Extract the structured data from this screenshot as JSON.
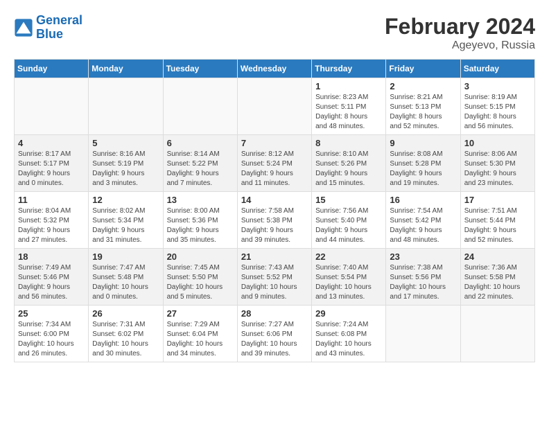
{
  "header": {
    "logo_line1": "General",
    "logo_line2": "Blue",
    "title": "February 2024",
    "subtitle": "Ageyevo, Russia"
  },
  "days_of_week": [
    "Sunday",
    "Monday",
    "Tuesday",
    "Wednesday",
    "Thursday",
    "Friday",
    "Saturday"
  ],
  "weeks": [
    [
      {
        "day": "",
        "info": ""
      },
      {
        "day": "",
        "info": ""
      },
      {
        "day": "",
        "info": ""
      },
      {
        "day": "",
        "info": ""
      },
      {
        "day": "1",
        "info": "Sunrise: 8:23 AM\nSunset: 5:11 PM\nDaylight: 8 hours\nand 48 minutes."
      },
      {
        "day": "2",
        "info": "Sunrise: 8:21 AM\nSunset: 5:13 PM\nDaylight: 8 hours\nand 52 minutes."
      },
      {
        "day": "3",
        "info": "Sunrise: 8:19 AM\nSunset: 5:15 PM\nDaylight: 8 hours\nand 56 minutes."
      }
    ],
    [
      {
        "day": "4",
        "info": "Sunrise: 8:17 AM\nSunset: 5:17 PM\nDaylight: 9 hours\nand 0 minutes."
      },
      {
        "day": "5",
        "info": "Sunrise: 8:16 AM\nSunset: 5:19 PM\nDaylight: 9 hours\nand 3 minutes."
      },
      {
        "day": "6",
        "info": "Sunrise: 8:14 AM\nSunset: 5:22 PM\nDaylight: 9 hours\nand 7 minutes."
      },
      {
        "day": "7",
        "info": "Sunrise: 8:12 AM\nSunset: 5:24 PM\nDaylight: 9 hours\nand 11 minutes."
      },
      {
        "day": "8",
        "info": "Sunrise: 8:10 AM\nSunset: 5:26 PM\nDaylight: 9 hours\nand 15 minutes."
      },
      {
        "day": "9",
        "info": "Sunrise: 8:08 AM\nSunset: 5:28 PM\nDaylight: 9 hours\nand 19 minutes."
      },
      {
        "day": "10",
        "info": "Sunrise: 8:06 AM\nSunset: 5:30 PM\nDaylight: 9 hours\nand 23 minutes."
      }
    ],
    [
      {
        "day": "11",
        "info": "Sunrise: 8:04 AM\nSunset: 5:32 PM\nDaylight: 9 hours\nand 27 minutes."
      },
      {
        "day": "12",
        "info": "Sunrise: 8:02 AM\nSunset: 5:34 PM\nDaylight: 9 hours\nand 31 minutes."
      },
      {
        "day": "13",
        "info": "Sunrise: 8:00 AM\nSunset: 5:36 PM\nDaylight: 9 hours\nand 35 minutes."
      },
      {
        "day": "14",
        "info": "Sunrise: 7:58 AM\nSunset: 5:38 PM\nDaylight: 9 hours\nand 39 minutes."
      },
      {
        "day": "15",
        "info": "Sunrise: 7:56 AM\nSunset: 5:40 PM\nDaylight: 9 hours\nand 44 minutes."
      },
      {
        "day": "16",
        "info": "Sunrise: 7:54 AM\nSunset: 5:42 PM\nDaylight: 9 hours\nand 48 minutes."
      },
      {
        "day": "17",
        "info": "Sunrise: 7:51 AM\nSunset: 5:44 PM\nDaylight: 9 hours\nand 52 minutes."
      }
    ],
    [
      {
        "day": "18",
        "info": "Sunrise: 7:49 AM\nSunset: 5:46 PM\nDaylight: 9 hours\nand 56 minutes."
      },
      {
        "day": "19",
        "info": "Sunrise: 7:47 AM\nSunset: 5:48 PM\nDaylight: 10 hours\nand 0 minutes."
      },
      {
        "day": "20",
        "info": "Sunrise: 7:45 AM\nSunset: 5:50 PM\nDaylight: 10 hours\nand 5 minutes."
      },
      {
        "day": "21",
        "info": "Sunrise: 7:43 AM\nSunset: 5:52 PM\nDaylight: 10 hours\nand 9 minutes."
      },
      {
        "day": "22",
        "info": "Sunrise: 7:40 AM\nSunset: 5:54 PM\nDaylight: 10 hours\nand 13 minutes."
      },
      {
        "day": "23",
        "info": "Sunrise: 7:38 AM\nSunset: 5:56 PM\nDaylight: 10 hours\nand 17 minutes."
      },
      {
        "day": "24",
        "info": "Sunrise: 7:36 AM\nSunset: 5:58 PM\nDaylight: 10 hours\nand 22 minutes."
      }
    ],
    [
      {
        "day": "25",
        "info": "Sunrise: 7:34 AM\nSunset: 6:00 PM\nDaylight: 10 hours\nand 26 minutes."
      },
      {
        "day": "26",
        "info": "Sunrise: 7:31 AM\nSunset: 6:02 PM\nDaylight: 10 hours\nand 30 minutes."
      },
      {
        "day": "27",
        "info": "Sunrise: 7:29 AM\nSunset: 6:04 PM\nDaylight: 10 hours\nand 34 minutes."
      },
      {
        "day": "28",
        "info": "Sunrise: 7:27 AM\nSunset: 6:06 PM\nDaylight: 10 hours\nand 39 minutes."
      },
      {
        "day": "29",
        "info": "Sunrise: 7:24 AM\nSunset: 6:08 PM\nDaylight: 10 hours\nand 43 minutes."
      },
      {
        "day": "",
        "info": ""
      },
      {
        "day": "",
        "info": ""
      }
    ]
  ]
}
